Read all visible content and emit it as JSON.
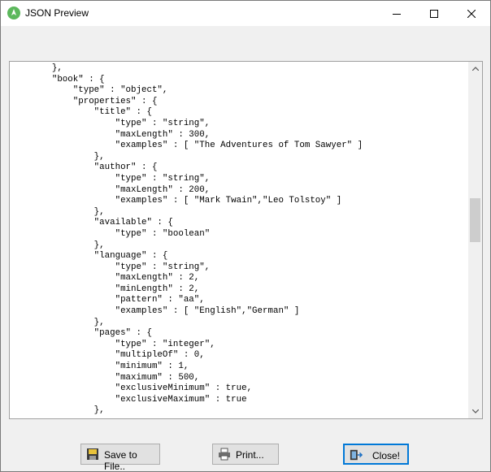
{
  "window": {
    "title": "JSON Preview"
  },
  "editor": {
    "lines": [
      "        },",
      "        \"book\" : {",
      "            \"type\" : \"object\",",
      "            \"properties\" : {",
      "                \"title\" : {",
      "                    \"type\" : \"string\",",
      "                    \"maxLength\" : 300,",
      "                    \"examples\" : [ \"The Adventures of Tom Sawyer\" ]",
      "                },",
      "                \"author\" : {",
      "                    \"type\" : \"string\",",
      "                    \"maxLength\" : 200,",
      "                    \"examples\" : [ \"Mark Twain\",\"Leo Tolstoy\" ]",
      "                },",
      "                \"available\" : {",
      "                    \"type\" : \"boolean\"",
      "                },",
      "                \"language\" : {",
      "                    \"type\" : \"string\",",
      "                    \"maxLength\" : 2,",
      "                    \"minLength\" : 2,",
      "                    \"pattern\" : \"aa\",",
      "                    \"examples\" : [ \"English\",\"German\" ]",
      "                },",
      "                \"pages\" : {",
      "                    \"type\" : \"integer\",",
      "                    \"multipleOf\" : 0,",
      "                    \"minimum\" : 1,",
      "                    \"maximum\" : 500,",
      "                    \"exclusiveMinimum\" : true,",
      "                    \"exclusiveMaximum\" : true",
      "                },"
    ]
  },
  "buttons": {
    "save_label": "Save to File..",
    "print_label": "Print...",
    "close_label": "Close!"
  },
  "icons": {
    "app": "app-leaf-icon",
    "save": "floppy-disk-icon",
    "print": "printer-icon",
    "close": "exit-door-icon"
  },
  "colors": {
    "app_icon": "#5cb85c",
    "focus_border": "#0078d7"
  }
}
